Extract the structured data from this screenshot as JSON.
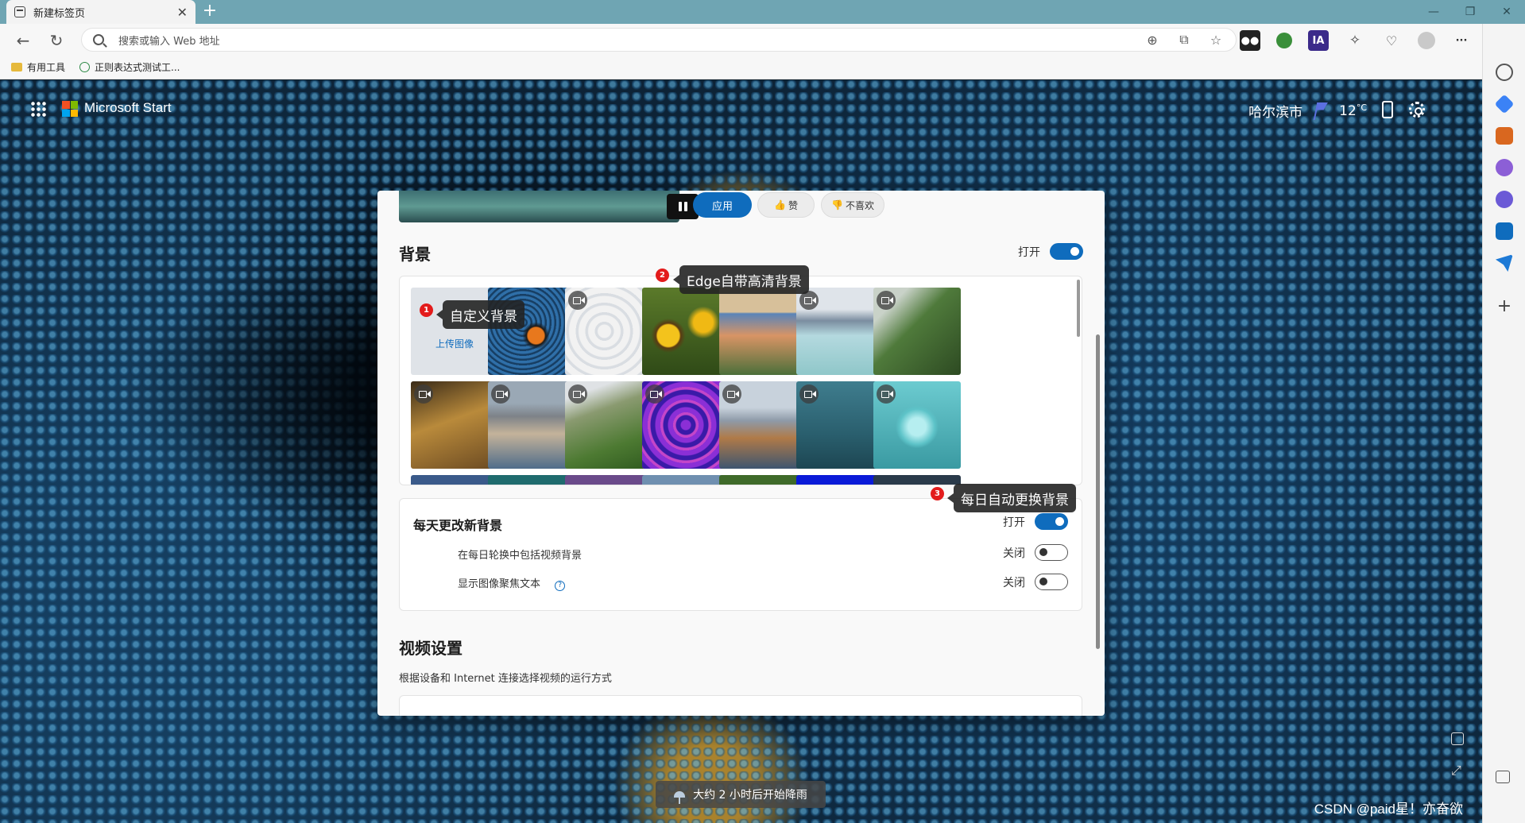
{
  "browser": {
    "tab_title": "新建标签页",
    "tab_close": "✕",
    "new_tab": "+",
    "window_controls": [
      "—",
      "❐",
      "✕"
    ],
    "address_placeholder": "搜索或输入 Web 地址",
    "bookmarks": [
      "有用工具",
      "正则表达式测试工..."
    ],
    "toolbar_icons": [
      "zoom-icon",
      "reader-icon",
      "favorite-icon",
      "extension-game-icon",
      "extension-globe-icon",
      "extension-ia-icon",
      "extensions-icon",
      "performance-icon",
      "profile-icon",
      "more-icon",
      "copilot-icon"
    ],
    "ia_badge": "IA",
    "more_label": "···"
  },
  "start": {
    "brand": "Microsoft Start",
    "city": "哈尔滨市",
    "temperature": "12",
    "temp_unit": "°C"
  },
  "dialog": {
    "apply": "应用",
    "like": "赞",
    "dislike": "不喜欢",
    "background_title": "背景",
    "background_toggle": "打开",
    "upload_label": "上传图像",
    "daily": {
      "title": "每天更改新背景",
      "toggle_label": "打开",
      "rows": [
        {
          "label": "在每日轮换中包括视频背景",
          "state": "关闭"
        },
        {
          "label": "显示图像聚焦文本",
          "state": "关闭"
        }
      ],
      "info_glyph": "?"
    },
    "video_title": "视频设置",
    "video_desc": "根据设备和 Internet 连接选择视频的运行方式"
  },
  "annotations": [
    {
      "num": "1",
      "text": "自定义背景"
    },
    {
      "num": "2",
      "text": "Edge自带高清背景"
    },
    {
      "num": "3",
      "text": "每日自动更换背景"
    }
  ],
  "bottom": {
    "rain": "大约 2 小时后开始降雨",
    "watermark": "CSDN @paid星！亦奋欲"
  },
  "colors": {
    "accent": "#0f6cbd",
    "tab_strip": "#6fa5b3",
    "badge_red": "#e31b1b"
  }
}
